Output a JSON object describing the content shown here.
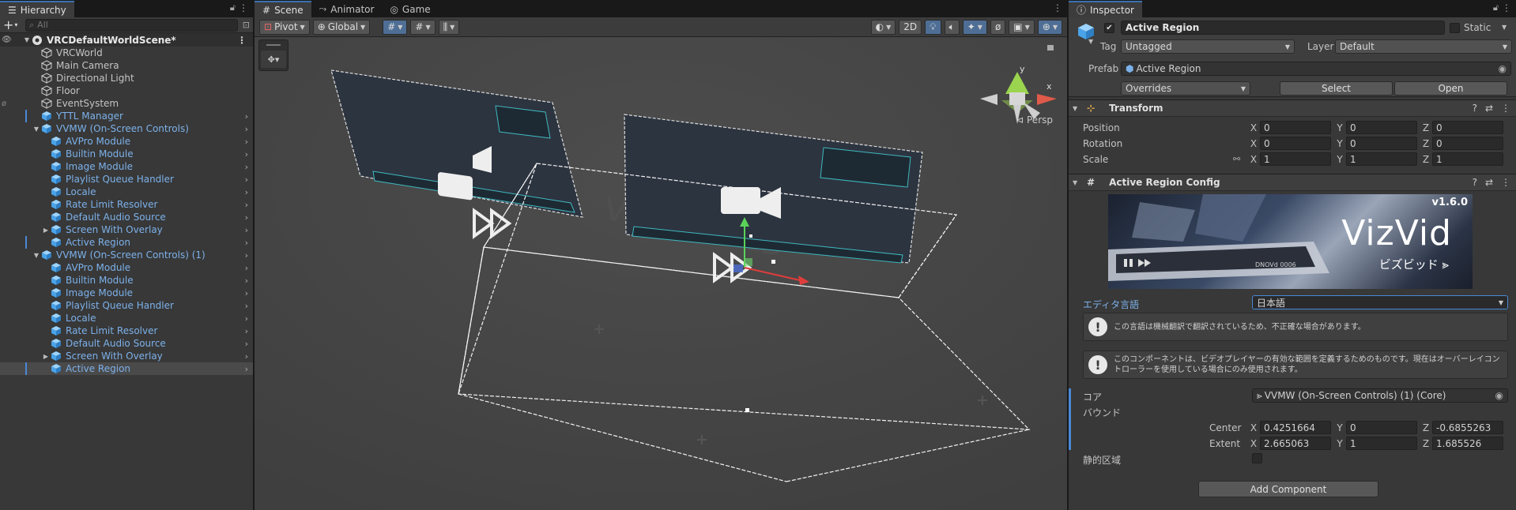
{
  "hierarchy": {
    "tab_label": "Hierarchy",
    "search_placeholder": "All",
    "scene_name": "VRCDefaultWorldScene*",
    "items": [
      {
        "label": "VRCWorld",
        "prefab": false,
        "indent": 1
      },
      {
        "label": "Main Camera",
        "prefab": false,
        "indent": 1
      },
      {
        "label": "Directional Light",
        "prefab": false,
        "indent": 1
      },
      {
        "label": "Floor",
        "prefab": false,
        "indent": 1
      },
      {
        "label": "EventSystem",
        "prefab": false,
        "indent": 1
      },
      {
        "label": "YTTL Manager",
        "prefab": true,
        "indent": 1,
        "chev": true,
        "bar": true
      },
      {
        "label": "VVMW (On-Screen Controls)",
        "prefab": true,
        "indent": 1,
        "chev": true,
        "expanded": true
      },
      {
        "label": "AVPro Module",
        "prefab": true,
        "indent": 2,
        "chev": true
      },
      {
        "label": "Builtin Module",
        "prefab": true,
        "indent": 2,
        "chev": true
      },
      {
        "label": "Image Module",
        "prefab": true,
        "indent": 2,
        "chev": true
      },
      {
        "label": "Playlist Queue Handler",
        "prefab": true,
        "indent": 2,
        "chev": true
      },
      {
        "label": "Locale",
        "prefab": true,
        "indent": 2,
        "chev": true
      },
      {
        "label": "Rate Limit Resolver",
        "prefab": true,
        "indent": 2,
        "chev": true
      },
      {
        "label": "Default Audio Source",
        "prefab": true,
        "indent": 2,
        "chev": true
      },
      {
        "label": "Screen With Overlay",
        "prefab": true,
        "indent": 2,
        "chev": true,
        "collapsed": true
      },
      {
        "label": "Active Region",
        "prefab": true,
        "indent": 2,
        "chev": true,
        "bar": true
      },
      {
        "label": "VVMW (On-Screen Controls) (1)",
        "prefab": true,
        "indent": 1,
        "chev": true,
        "expanded": true
      },
      {
        "label": "AVPro Module",
        "prefab": true,
        "indent": 2,
        "chev": true
      },
      {
        "label": "Builtin Module",
        "prefab": true,
        "indent": 2,
        "chev": true
      },
      {
        "label": "Image Module",
        "prefab": true,
        "indent": 2,
        "chev": true
      },
      {
        "label": "Playlist Queue Handler",
        "prefab": true,
        "indent": 2,
        "chev": true
      },
      {
        "label": "Locale",
        "prefab": true,
        "indent": 2,
        "chev": true
      },
      {
        "label": "Rate Limit Resolver",
        "prefab": true,
        "indent": 2,
        "chev": true
      },
      {
        "label": "Default Audio Source",
        "prefab": true,
        "indent": 2,
        "chev": true
      },
      {
        "label": "Screen With Overlay",
        "prefab": true,
        "indent": 2,
        "chev": true,
        "collapsed": true
      },
      {
        "label": "Active Region",
        "prefab": true,
        "indent": 2,
        "chev": true,
        "selected": true,
        "bar": true
      }
    ]
  },
  "scene": {
    "tabs": [
      "Scene",
      "Animator",
      "Game"
    ],
    "pivot_label": "Pivot",
    "global_label": "Global",
    "mode_2d": "2D",
    "persp_label": "Persp",
    "gizmo_y": "y",
    "gizmo_x": "x"
  },
  "inspector": {
    "tab_label": "Inspector",
    "object_name": "Active Region",
    "static_label": "Static",
    "tag_label": "Tag",
    "tag_value": "Untagged",
    "layer_label": "Layer",
    "layer_value": "Default",
    "prefab_label": "Prefab",
    "prefab_value": "Active Region",
    "overrides_label": "Overrides",
    "select_label": "Select",
    "open_label": "Open",
    "transform": {
      "title": "Transform",
      "position_label": "Position",
      "rotation_label": "Rotation",
      "scale_label": "Scale",
      "position": [
        "0",
        "0",
        "0"
      ],
      "rotation": [
        "0",
        "0",
        "0"
      ],
      "scale": [
        "1",
        "1",
        "1"
      ]
    },
    "config": {
      "title": "Active Region Config",
      "banner_version": "v1.6.0",
      "banner_title": "VizVid",
      "banner_subtitle": "ビズビッド ⪢",
      "banner_code": "DNOVd 0006",
      "lang_label": "エディタ言語",
      "lang_value": "日本語",
      "help1": "この言語は機械翻訳で翻訳されているため、不正確な場合があります。",
      "help2": "このコンポーネントは、ビデオプレイヤーの有効な範囲を定義するためのものです。現在はオーバーレイコントローラーを使用している場合にのみ使用されます。",
      "core_label": "コア",
      "core_value": "VVMW (On-Screen Controls) (1) (Core)",
      "bounds_label": "バウンド",
      "center_label": "Center",
      "extent_label": "Extent",
      "center": [
        "0.4251664",
        "0",
        "-0.6855263"
      ],
      "extent": [
        "2.665063",
        "1",
        "1.685526"
      ],
      "static_region_label": "静的区域"
    },
    "add_component_label": "Add Component"
  },
  "colors": {
    "accent_blue": "#4a88d6",
    "prefab_text": "#7cb1ea",
    "panel_bg": "#383838"
  }
}
